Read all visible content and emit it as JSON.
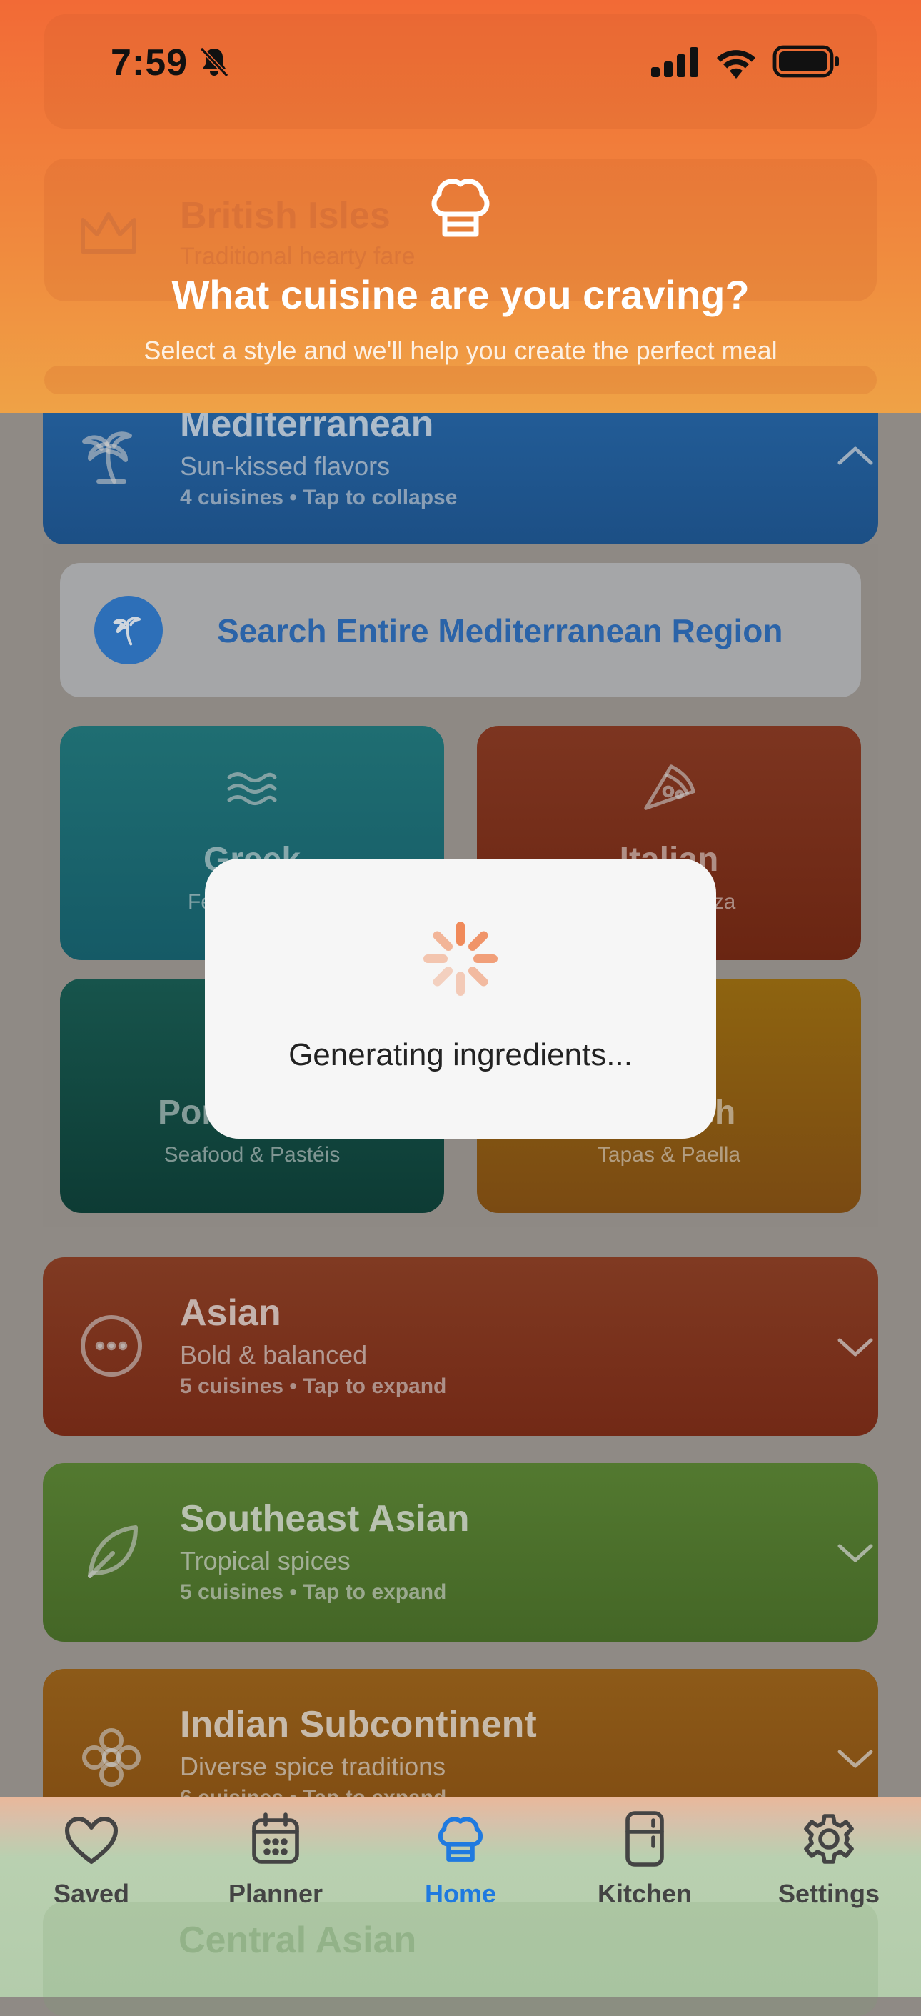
{
  "status": {
    "time": "7:59"
  },
  "header": {
    "title": "What cuisine are you craving?",
    "subtitle": "Select a style and we'll help you create the perfect meal",
    "ghost_title": "British Isles",
    "ghost_sub": "Traditional hearty fare"
  },
  "mediterranean": {
    "title": "Mediterranean",
    "subtitle": "Sun-kissed flavors",
    "meta": "4 cuisines • Tap to collapse",
    "search_label": "Search Entire Mediterranean Region",
    "tiles": [
      {
        "name": "Greek",
        "sub": "Feta & Olives"
      },
      {
        "name": "Italian",
        "sub": "Pasta & Pizza"
      },
      {
        "name": "Portuguese",
        "sub": "Seafood & Pastéis"
      },
      {
        "name": "Spanish",
        "sub": "Tapas & Paella"
      }
    ]
  },
  "regions": [
    {
      "title": "Asian",
      "subtitle": "Bold & balanced",
      "meta": "5 cuisines • Tap to expand"
    },
    {
      "title": "Southeast Asian",
      "subtitle": "Tropical spices",
      "meta": "5 cuisines • Tap to expand"
    },
    {
      "title": "Indian Subcontinent",
      "subtitle": "Diverse spice traditions",
      "meta": "6 cuisines • Tap to expand"
    },
    {
      "title": "Central Asian"
    }
  ],
  "modal": {
    "text": "Generating ingredients..."
  },
  "tabs": [
    {
      "label": "Saved",
      "icon": "heart-icon"
    },
    {
      "label": "Planner",
      "icon": "calendar-icon"
    },
    {
      "label": "Home",
      "icon": "chef-hat-icon",
      "active": true
    },
    {
      "label": "Kitchen",
      "icon": "fridge-icon"
    },
    {
      "label": "Settings",
      "icon": "gear-icon"
    }
  ],
  "colors": {
    "accent": "#1f7ae0",
    "header_orange": "#f26a36",
    "mediterranean_blue": "#1d5fa6",
    "asian_red": "#7e3420",
    "southeast_green": "#4d6f2a",
    "indian_orange": "#8a5418"
  }
}
